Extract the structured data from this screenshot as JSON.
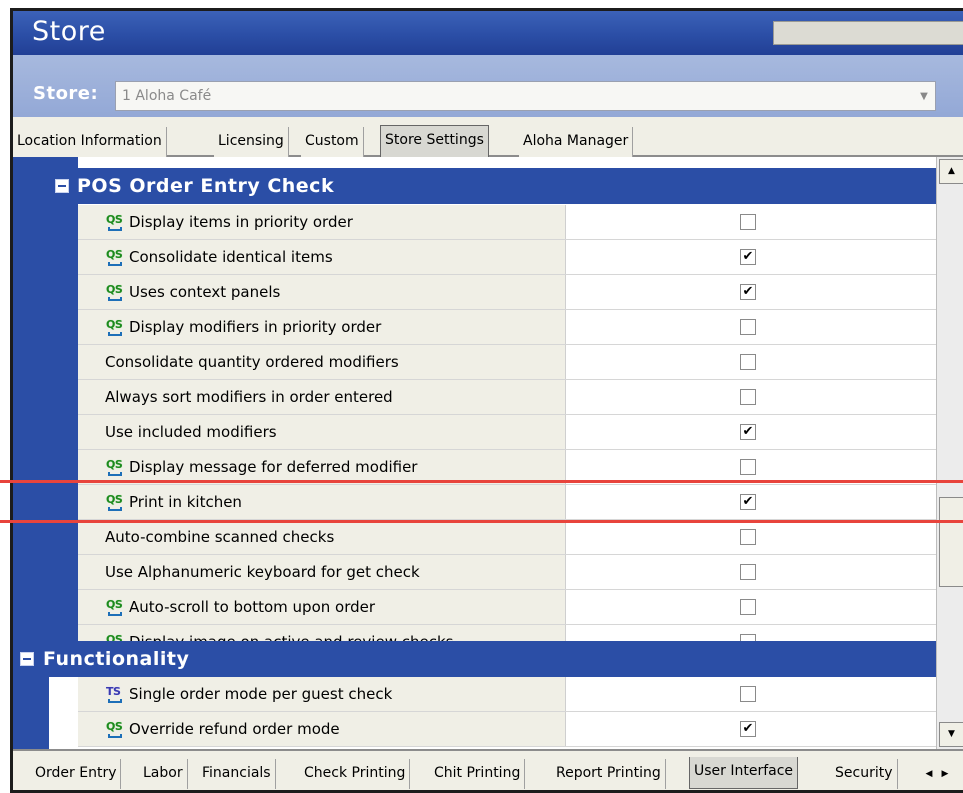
{
  "window": {
    "title": "Store"
  },
  "store": {
    "label": "Store:",
    "value": "1 Aloha Café"
  },
  "top_tabs": [
    {
      "label": "Location Information",
      "active": false
    },
    {
      "label": "Licensing",
      "active": false
    },
    {
      "label": "Custom",
      "active": false
    },
    {
      "label": "Store Settings",
      "active": true
    },
    {
      "label": "Aloha Manager",
      "active": false
    }
  ],
  "groups": [
    {
      "title": "POS Order Entry Check",
      "rows": [
        {
          "icon": "qs-icon",
          "label": "Display items in priority order",
          "checked": false
        },
        {
          "icon": "qs-icon",
          "label": "Consolidate identical items",
          "checked": true
        },
        {
          "icon": "qs-icon",
          "label": "Uses context panels",
          "checked": true
        },
        {
          "icon": "qs-icon",
          "label": "Display modifiers in priority order",
          "checked": false
        },
        {
          "icon": "",
          "label": "Consolidate quantity ordered modifiers",
          "checked": false
        },
        {
          "icon": "",
          "label": "Always sort modifiers in order entered",
          "checked": false
        },
        {
          "icon": "",
          "label": "Use included modifiers",
          "checked": true
        },
        {
          "icon": "qs-icon",
          "label": "Display message for deferred modifier",
          "checked": false
        },
        {
          "icon": "qs-icon",
          "label": "Print in kitchen",
          "checked": true
        },
        {
          "icon": "",
          "label": "Auto-combine scanned checks",
          "checked": false
        },
        {
          "icon": "",
          "label": "Use Alphanumeric keyboard for get check",
          "checked": false
        },
        {
          "icon": "qs-icon",
          "label": "Auto-scroll to bottom upon order",
          "checked": false
        },
        {
          "icon": "qs-icon",
          "label": "Display image on active and review checks",
          "checked": false
        }
      ]
    },
    {
      "title": "Functionality",
      "rows": [
        {
          "icon": "ts-icon",
          "label": "Single order mode per guest check",
          "checked": false
        },
        {
          "icon": "qs-icon",
          "label": "Override refund order mode",
          "checked": true
        }
      ]
    }
  ],
  "icons": {
    "qs": "QS",
    "ts": "TS",
    "check_mark": "✔",
    "scroll_up": "▲",
    "scroll_down": "▼",
    "tab_prev": "◀",
    "tab_next": "▶"
  },
  "bottom_tabs": [
    {
      "label": "Order Entry",
      "active": false
    },
    {
      "label": "Labor",
      "active": false
    },
    {
      "label": "Financials",
      "active": false
    },
    {
      "label": "Check Printing",
      "active": false
    },
    {
      "label": "Chit Printing",
      "active": false
    },
    {
      "label": "Report Printing",
      "active": false
    },
    {
      "label": "User Interface",
      "active": true
    },
    {
      "label": "Security",
      "active": false
    }
  ],
  "colors": {
    "header_blue": "#2b4ea6",
    "highlight_red": "#e8443c"
  }
}
